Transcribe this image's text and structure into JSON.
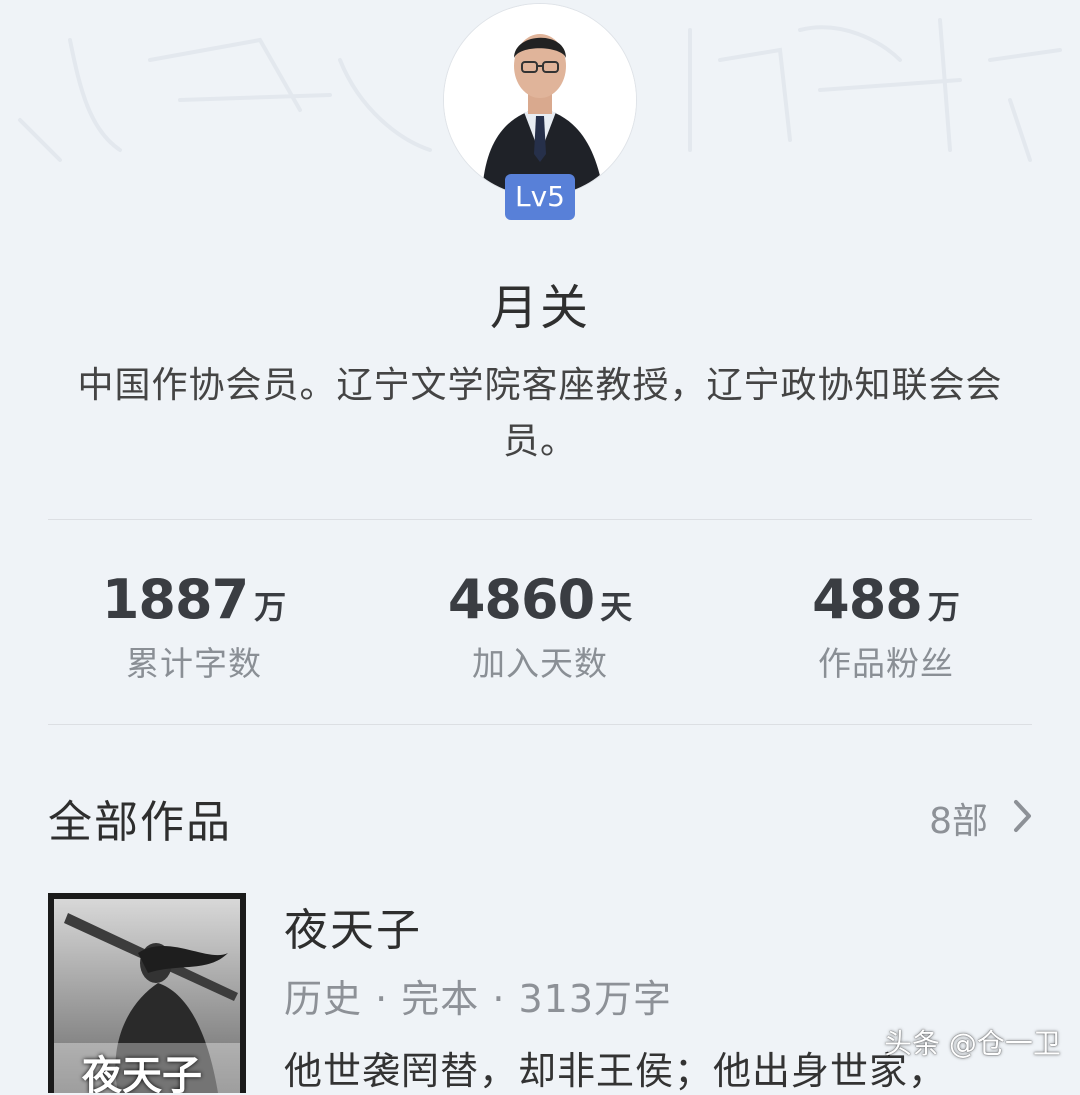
{
  "profile": {
    "level_badge": "Lv5",
    "name": "月关",
    "bio": "中国作协会员。辽宁文学院客座教授，辽宁政协知联会会员。"
  },
  "stats": [
    {
      "value": "1887",
      "unit": "万",
      "label": "累计字数"
    },
    {
      "value": "4860",
      "unit": "天",
      "label": "加入天数"
    },
    {
      "value": "488",
      "unit": "万",
      "label": "作品粉丝"
    }
  ],
  "works": {
    "title": "全部作品",
    "count": "8部",
    "chevron_icon": "chevron-right-icon",
    "books": [
      {
        "title": "夜天子",
        "meta": "历史 · 完本 · 313万字",
        "description": "他世袭罔替，却非王侯；他出身世家，",
        "cover_text": "夜天子"
      }
    ]
  },
  "watermark": "头条 @仓一卫",
  "colors": {
    "background": "#eff3f7",
    "badge": "#5880d8"
  }
}
